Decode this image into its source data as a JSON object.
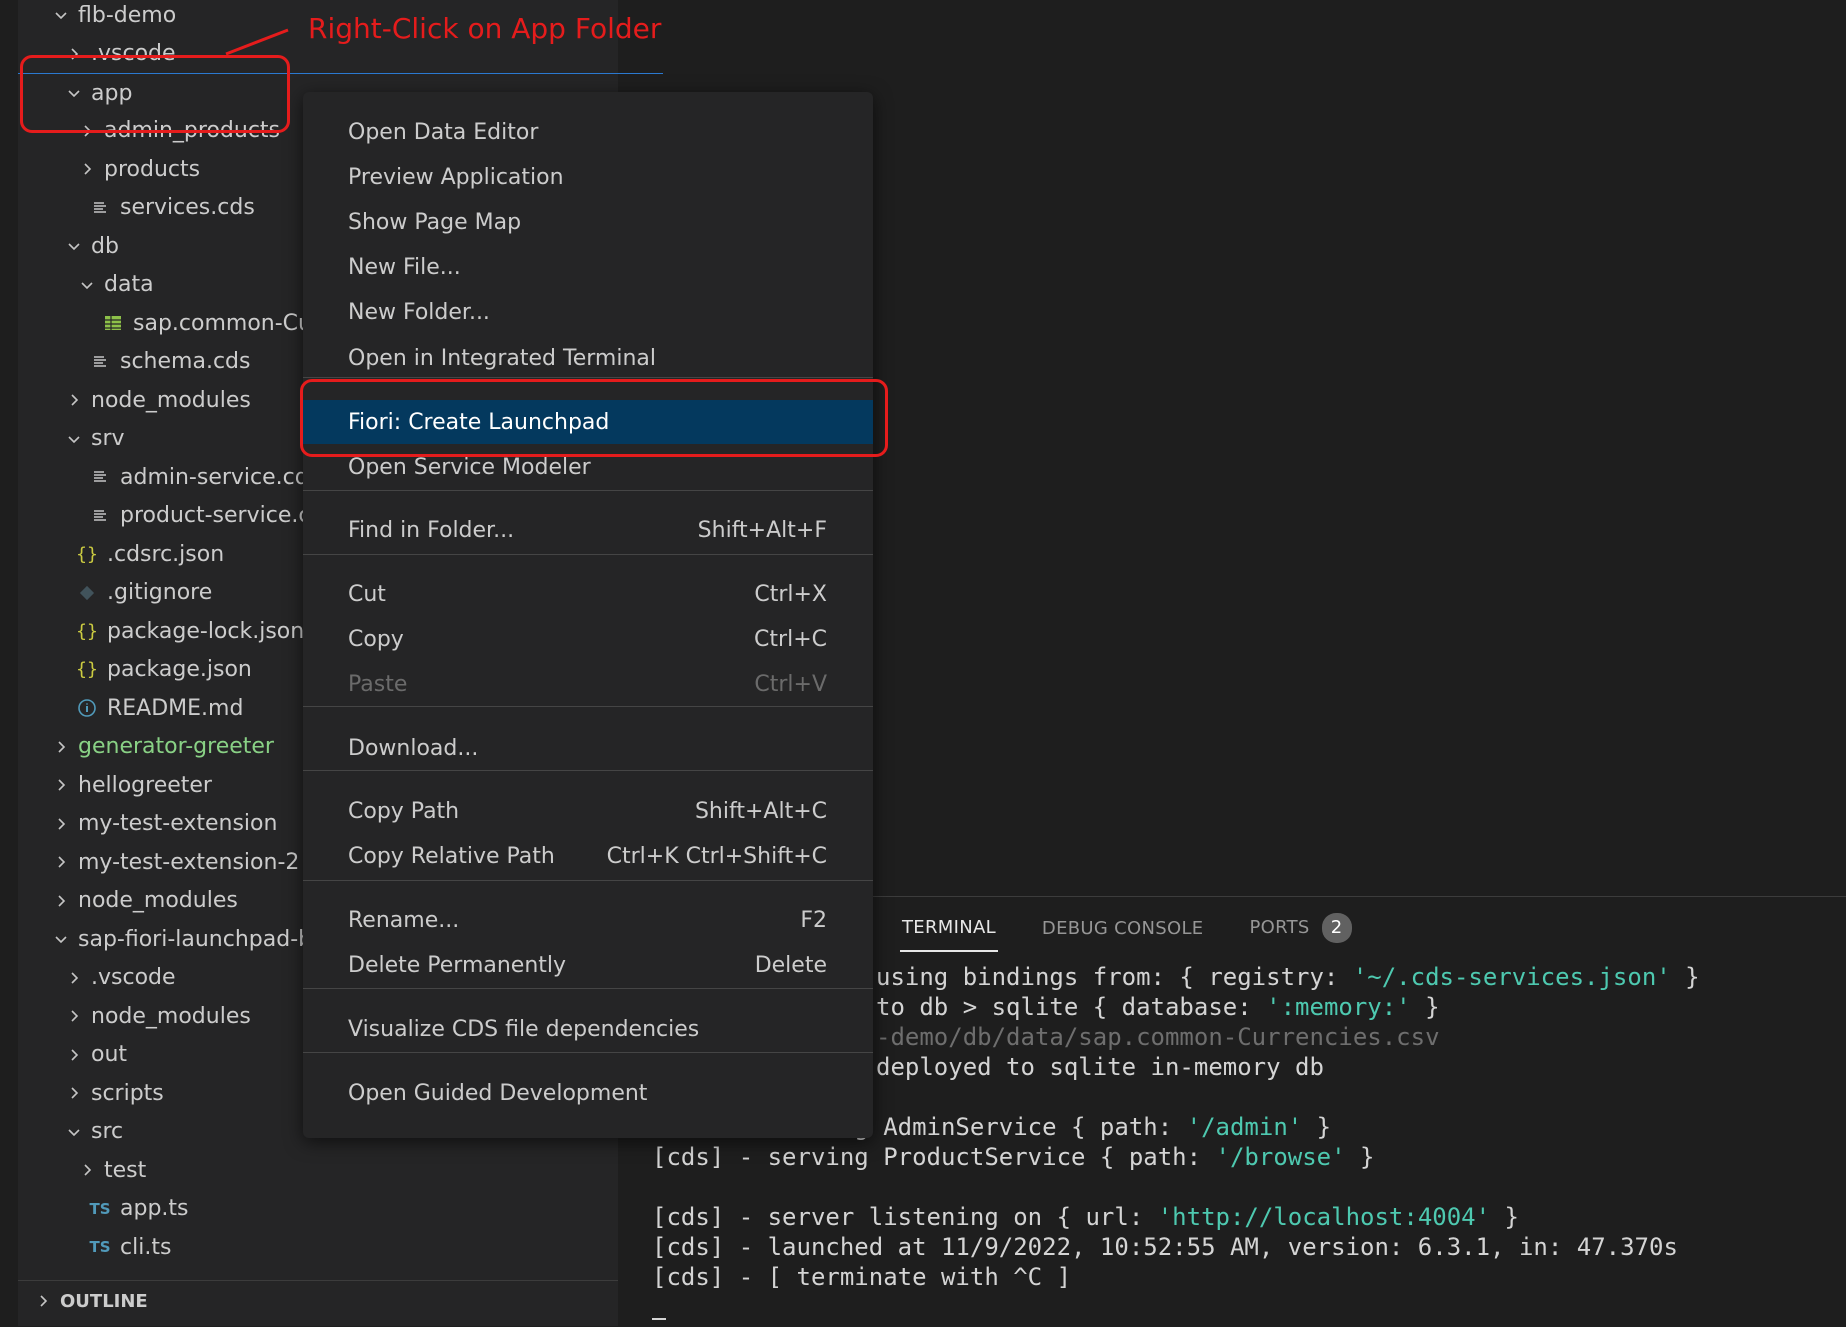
{
  "explorer": {
    "items": [
      {
        "label": "flb-demo",
        "chevron": "down",
        "icon": ""
      },
      {
        "label": ".vscode",
        "chevron": "right",
        "icon": ""
      },
      {
        "label": "app",
        "chevron": "down",
        "icon": ""
      },
      {
        "label": "admin_products",
        "chevron": "right",
        "icon": ""
      },
      {
        "label": "products",
        "chevron": "right",
        "icon": ""
      },
      {
        "label": "services.cds",
        "chevron": "",
        "icon": "lines-icon"
      },
      {
        "label": "db",
        "chevron": "down",
        "icon": ""
      },
      {
        "label": "data",
        "chevron": "down",
        "icon": ""
      },
      {
        "label": "sap.common-Curr",
        "chevron": "",
        "icon": "table-icon"
      },
      {
        "label": "schema.cds",
        "chevron": "",
        "icon": "lines-icon"
      },
      {
        "label": "node_modules",
        "chevron": "right",
        "icon": ""
      },
      {
        "label": "srv",
        "chevron": "down",
        "icon": ""
      },
      {
        "label": "admin-service.cds",
        "chevron": "",
        "icon": "lines-icon"
      },
      {
        "label": "product-service.cds",
        "chevron": "",
        "icon": "lines-icon"
      },
      {
        "label": ".cdsrc.json",
        "chevron": "",
        "icon": "braces-icon"
      },
      {
        "label": ".gitignore",
        "chevron": "",
        "icon": "git-icon"
      },
      {
        "label": "package-lock.json",
        "chevron": "",
        "icon": "braces-icon"
      },
      {
        "label": "package.json",
        "chevron": "",
        "icon": "braces-icon"
      },
      {
        "label": "README.md",
        "chevron": "",
        "icon": "info-icon"
      },
      {
        "label": "generator-greeter",
        "chevron": "right",
        "icon": ""
      },
      {
        "label": "hellogreeter",
        "chevron": "right",
        "icon": ""
      },
      {
        "label": "my-test-extension",
        "chevron": "right",
        "icon": ""
      },
      {
        "label": "my-test-extension-2",
        "chevron": "right",
        "icon": ""
      },
      {
        "label": "node_modules",
        "chevron": "right",
        "icon": ""
      },
      {
        "label": "sap-fiori-launchpad-b",
        "chevron": "down",
        "icon": ""
      },
      {
        "label": ".vscode",
        "chevron": "right",
        "icon": ""
      },
      {
        "label": "node_modules",
        "chevron": "right",
        "icon": ""
      },
      {
        "label": "out",
        "chevron": "right",
        "icon": ""
      },
      {
        "label": "scripts",
        "chevron": "right",
        "icon": ""
      },
      {
        "label": "src",
        "chevron": "down",
        "icon": ""
      },
      {
        "label": "test",
        "chevron": "right",
        "icon": ""
      },
      {
        "label": "app.ts",
        "chevron": "",
        "icon": "ts-icon"
      },
      {
        "label": "cli.ts",
        "chevron": "",
        "icon": "ts-icon"
      }
    ],
    "ts_badge": "TS",
    "outline_label": "OUTLINE"
  },
  "annotation": {
    "text": "Right-Click on App Folder",
    "color": "#e51c1c"
  },
  "context_menu": {
    "items": [
      {
        "label": "Open Data Editor",
        "shortcut": ""
      },
      {
        "label": "Preview Application",
        "shortcut": ""
      },
      {
        "label": "Show Page Map",
        "shortcut": ""
      },
      {
        "label": "New File...",
        "shortcut": ""
      },
      {
        "label": "New Folder...",
        "shortcut": ""
      },
      {
        "label": "Open in Integrated Terminal",
        "shortcut": ""
      },
      {
        "label": "Fiori: Create Launchpad",
        "shortcut": ""
      },
      {
        "label": "Open Service Modeler",
        "shortcut": ""
      },
      {
        "label": "Find in Folder...",
        "shortcut": "Shift+Alt+F"
      },
      {
        "label": "Cut",
        "shortcut": "Ctrl+X"
      },
      {
        "label": "Copy",
        "shortcut": "Ctrl+C"
      },
      {
        "label": "Paste",
        "shortcut": "Ctrl+V"
      },
      {
        "label": "Download...",
        "shortcut": ""
      },
      {
        "label": "Copy Path",
        "shortcut": "Shift+Alt+C"
      },
      {
        "label": "Copy Relative Path",
        "shortcut": "Ctrl+K Ctrl+Shift+C"
      },
      {
        "label": "Rename...",
        "shortcut": "F2"
      },
      {
        "label": "Delete Permanently",
        "shortcut": "Delete"
      },
      {
        "label": "Visualize CDS file dependencies",
        "shortcut": ""
      },
      {
        "label": "Open Guided Development",
        "shortcut": ""
      }
    ],
    "highlight_color": "#04395e"
  },
  "panel": {
    "tabs": [
      {
        "label": "TERMINAL"
      },
      {
        "label": "DEBUG CONSOLE"
      },
      {
        "label": "PORTS"
      }
    ],
    "ports_count": "2"
  },
  "terminal": {
    "lines": [
      {
        "pre": "using bindings from: { registry: ",
        "str": "'~/.cds-services.json'",
        "post": " }"
      },
      {
        "pre": "to db > sqlite { database: ",
        "str": "':memory:'",
        "post": " }"
      },
      {
        "dim": "-demo/db/data/sap.common-Currencies.csv"
      },
      {
        "pre": "deployed to sqlite in-memory db"
      },
      {
        "pre": "[cds] - serving AdminService { path: ",
        "str": "'/admin'",
        "post": " }"
      },
      {
        "pre": "[cds] - serving ProductService { path: ",
        "str": "'/browse'",
        "post": " }"
      },
      {
        "pre": "[cds] - server listening on { url: ",
        "str": "'http://localhost:4004'",
        "post": " }"
      },
      {
        "pre": "[cds] - launched at 11/9/2022, 10:52:55 AM, version: 6.3.1, in: 47.370s"
      },
      {
        "pre": "[cds] - [ terminate with ^C ]"
      }
    ]
  }
}
